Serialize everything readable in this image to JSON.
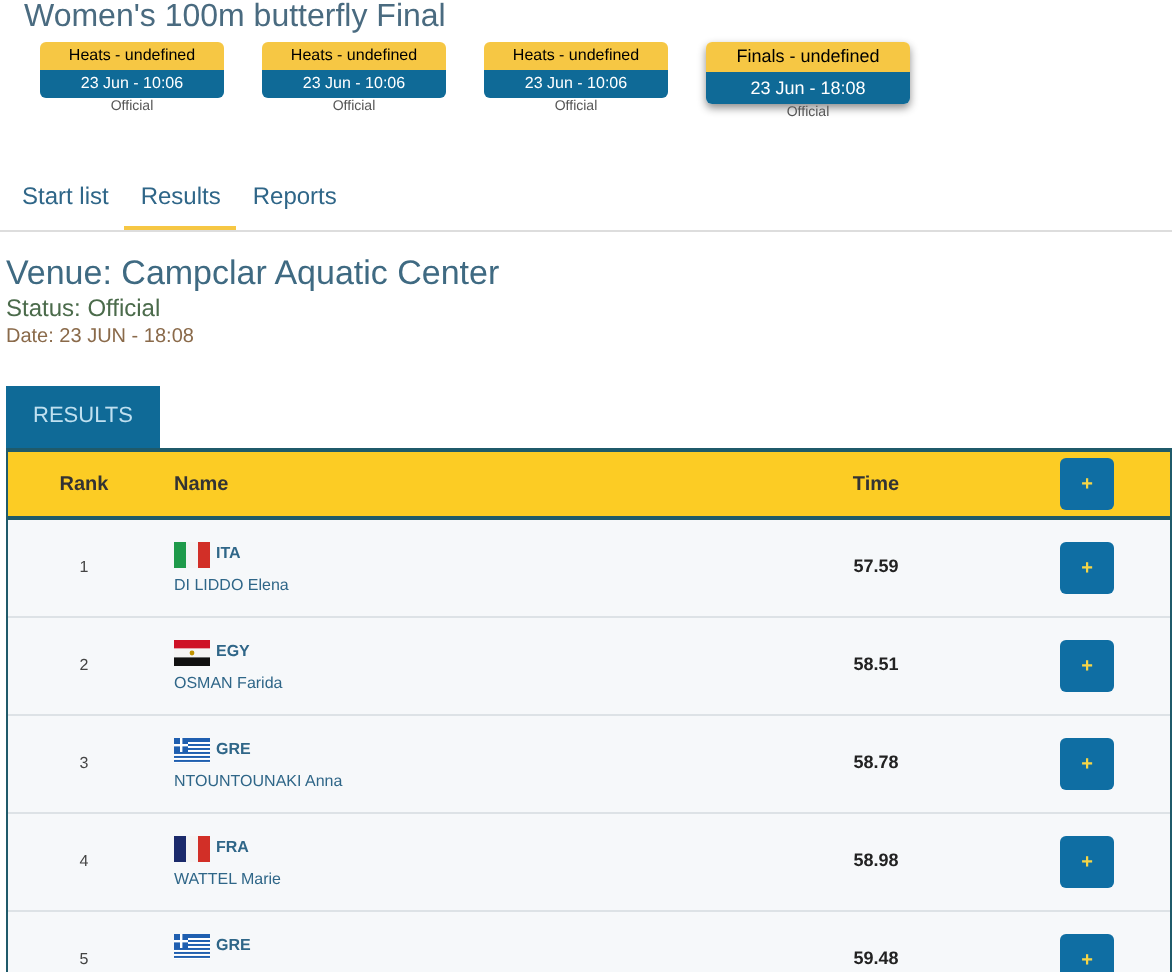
{
  "title": "Women's 100m butterfly Final",
  "phases": [
    {
      "label": "Heats - undefined",
      "time": "23 Jun - 10:06",
      "status": "Official",
      "selected": false
    },
    {
      "label": "Heats - undefined",
      "time": "23 Jun - 10:06",
      "status": "Official",
      "selected": false
    },
    {
      "label": "Heats - undefined",
      "time": "23 Jun - 10:06",
      "status": "Official",
      "selected": false
    },
    {
      "label": "Finals - undefined",
      "time": "23 Jun - 18:08",
      "status": "Official",
      "selected": true
    }
  ],
  "tabs": [
    {
      "label": "Start list",
      "selected": false
    },
    {
      "label": "Results",
      "selected": true
    },
    {
      "label": "Reports",
      "selected": false
    }
  ],
  "venue": "Venue: Campclar Aquatic Center",
  "status": "Status: Official",
  "date": "Date: 23 JUN - 18:08",
  "section_tab": "RESULTS",
  "table": {
    "columns": [
      "Rank",
      "Name",
      "Time"
    ],
    "header_button": "+",
    "rows": [
      {
        "rank": "1",
        "kind": "it",
        "country": "ITA",
        "name": "DI LIDDO Elena",
        "time": "57.59",
        "button": "+"
      },
      {
        "rank": "2",
        "kind": "eg",
        "country": "EGY",
        "name": "OSMAN Farida",
        "time": "58.51",
        "button": "+"
      },
      {
        "rank": "3",
        "kind": "gr",
        "country": "GRE",
        "name": "NTOUNTOUNAKI Anna",
        "time": "58.78",
        "button": "+"
      },
      {
        "rank": "4",
        "kind": "fr",
        "country": "FRA",
        "name": "WATTEL Marie",
        "time": "58.98",
        "button": "+"
      },
      {
        "rank": "5",
        "kind": "gr",
        "country": "GRE",
        "time": "59.48",
        "button": "+"
      }
    ]
  }
}
